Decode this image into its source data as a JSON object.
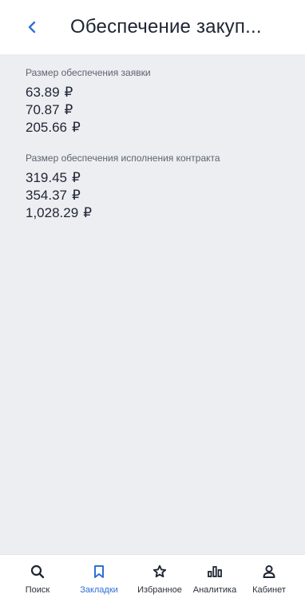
{
  "header": {
    "title": "Обеспечение закуп...",
    "back_icon": "chevron-left-icon",
    "accent_color": "#2f6fd6"
  },
  "sections": [
    {
      "label": "Размер обеспечения заявки",
      "amounts": [
        {
          "value": "63.89",
          "currency": "₽"
        },
        {
          "value": "70.87",
          "currency": "₽"
        },
        {
          "value": "205.66",
          "currency": "₽"
        }
      ]
    },
    {
      "label": "Размер обеспечения исполнения контракта",
      "amounts": [
        {
          "value": "319.45",
          "currency": "₽"
        },
        {
          "value": "354.37",
          "currency": "₽"
        },
        {
          "value": "1,028.29",
          "currency": "₽"
        }
      ]
    }
  ],
  "bottom_nav": {
    "items": [
      {
        "label": "Поиск",
        "icon": "search-icon",
        "active": false
      },
      {
        "label": "Закладки",
        "icon": "bookmark-icon",
        "active": true
      },
      {
        "label": "Избранное",
        "icon": "star-icon",
        "active": false
      },
      {
        "label": "Аналитика",
        "icon": "analytics-icon",
        "active": false
      },
      {
        "label": "Кабинет",
        "icon": "user-icon",
        "active": false
      }
    ]
  }
}
